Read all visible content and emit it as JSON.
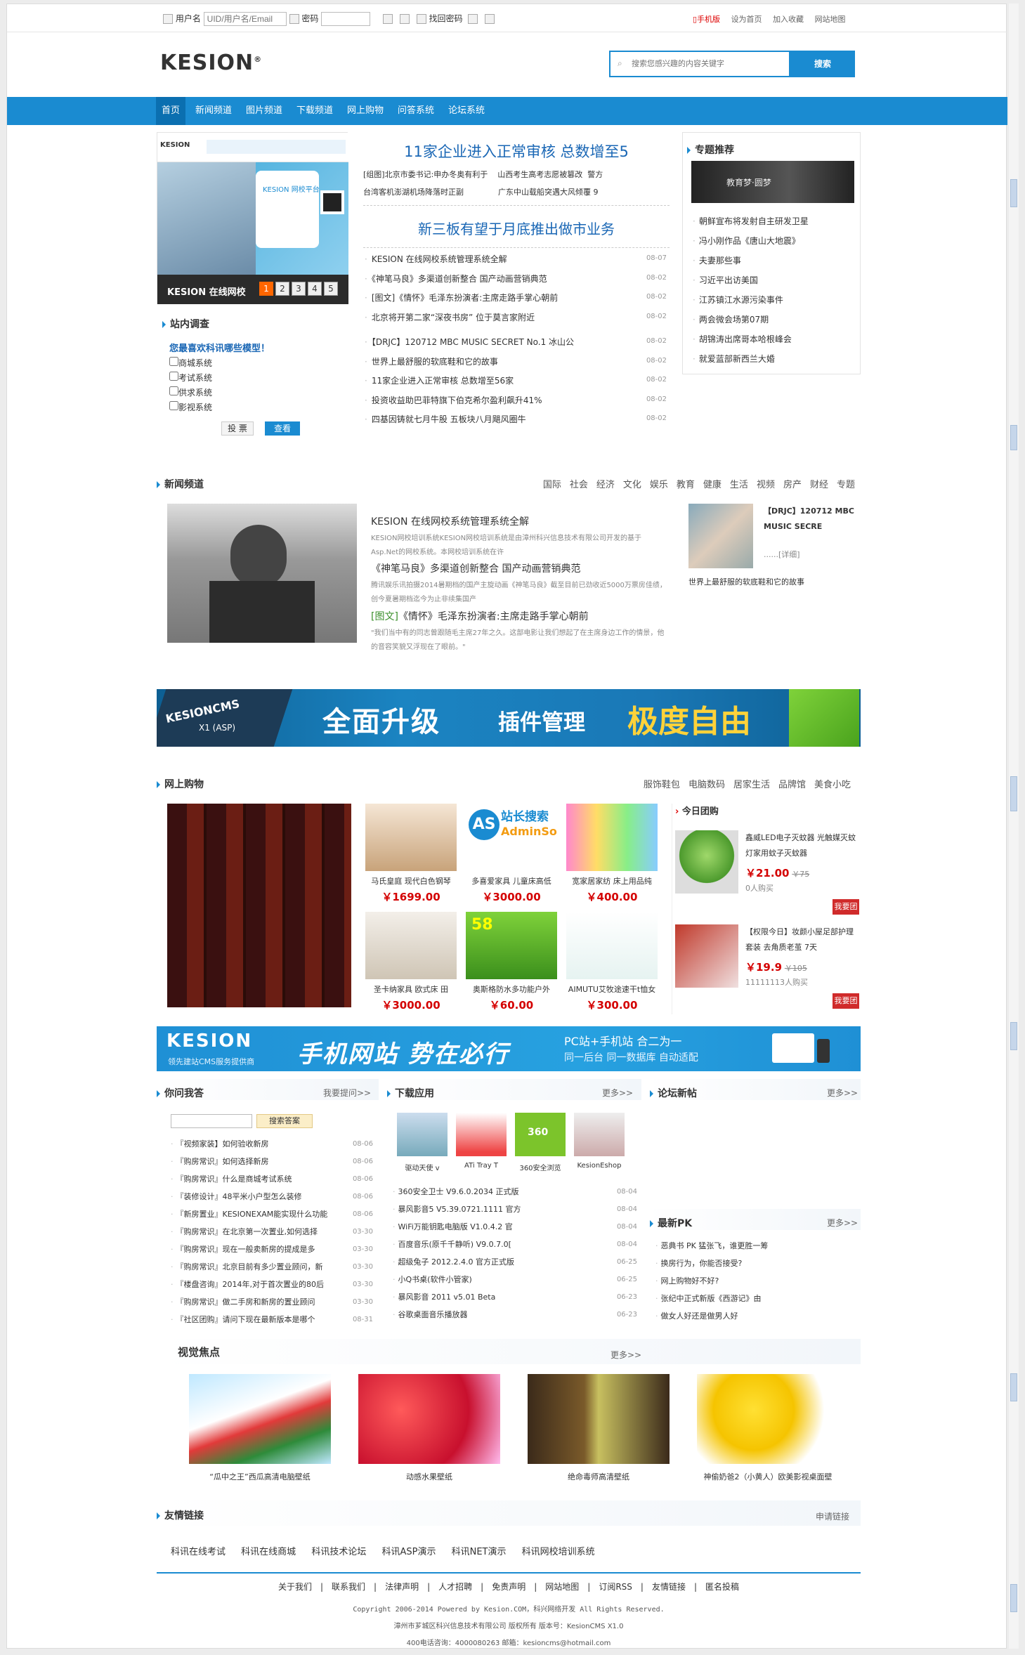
{
  "topbar": {
    "username_label": "用户名",
    "username_placeholder": "UID/用户名/Email",
    "password_label": "密码",
    "forgot": "找回密码",
    "links": [
      "手机版",
      "设为首页",
      "加入收藏",
      "网站地图"
    ]
  },
  "header": {
    "logo": "KESION",
    "logo_mark": "®",
    "search_placeholder": "搜索您感兴趣的内容关键字",
    "search_button": "搜索"
  },
  "nav": [
    "首页",
    "新闻频道",
    "图片频道",
    "下载频道",
    "网上购物",
    "问答系统",
    "论坛系统"
  ],
  "slider": {
    "caption": "KESION 在线网校",
    "pages": [
      "1",
      "2",
      "3",
      "4",
      "5"
    ],
    "banner_text": "KESION 网校平台"
  },
  "survey": {
    "title": "站内调查",
    "question": "您最喜欢科讯哪些模型！",
    "options": [
      "商城系统",
      "考试系统",
      "供求系统",
      "影视系统"
    ],
    "vote_btn": "投 票",
    "view_btn": "查看"
  },
  "headlines": {
    "h1": "11家企业进入正常审核  总数增至5",
    "h1_line1": "[组图]北京市委书记:申办冬奥有利于    山西考生高考志愿被篡改  警方",
    "h1_line2": "台湾客机澎湖机场降落时正副              广东中山载船突遇大风倾覆 9",
    "h2": "新三板有望于月底推出做市业务"
  },
  "newslist": [
    {
      "t": "KESION 在线网校系统管理系统全解",
      "d": "08-07"
    },
    {
      "t": "《神笔马良》多渠道创新整合 国产动画营销典范",
      "d": "08-02"
    },
    {
      "t": "[图文]《情怀》毛泽东扮演者:主席走路手掌心朝前",
      "d": "08-02"
    },
    {
      "t": "北京将开第二家“深夜书房” 位于莫言家附近",
      "d": "08-02"
    },
    {
      "t": "【DRJC】120712 MBC MUSIC SECRET No.1 冰山公",
      "d": "08-02"
    },
    {
      "t": "世界上最舒服的软底鞋和它的故事",
      "d": "08-02"
    },
    {
      "t": "11家企业进入正常审核 总数增至56家",
      "d": "08-02"
    },
    {
      "t": "投资收益助巴菲特旗下伯克希尔盈利飙升41%",
      "d": "08-02"
    },
    {
      "t": "四基因铸就七月牛股 五板块八月飓风圈牛",
      "d": "08-02"
    }
  ],
  "topics": {
    "title": "专题推荐",
    "items": [
      "朝鲜宣布将发射自主研发卫星",
      "冯小刚作品《唐山大地震》",
      "夫妻那些事",
      "习近平出访美国",
      "江苏镇江水源污染事件",
      "两会微会场第07期",
      "胡锦涛出席哥本哈根峰会",
      "就爱蓝部新西兰大婚"
    ],
    "img_text": "教育梦·圆梦"
  },
  "newsch": {
    "title": "新闻频道",
    "cats": [
      "国际",
      "社会",
      "经济",
      "文化",
      "娱乐",
      "教育",
      "健康",
      "生活",
      "视频",
      "房产",
      "财经",
      "专题"
    ],
    "a1_t": "KESION 在线网校系统管理系统全解",
    "a1_d": "KESION网校培训系统KESION网校培训系统是由漳州科兴信息技术有限公司开发的基于Asp.Net的网校系统。本网校培训系统在许",
    "a2_t": "《神笔马良》多渠道创新整合 国产动画营销典范",
    "a2_d": "腾讯娱乐讯拍摄2014暑期档的国产主旋动画《神笔马良》截至目前已劲收近5000万票房佳绩，创今夏暑期档迄今为止非续集国产",
    "a3_tag": "[图文]",
    "a3_t": "《情怀》毛泽东扮演者:主席走路手掌心朝前",
    "a3_d": "\"我们当中有的同志曾跟随毛主席27年之久。这部电影让我们想起了在主席身边工作的情景，他的音容笑貌又浮现在了眼前。\"",
    "side_t": "【DRJC】120712 MBC MUSIC SECRE",
    "side_more": "......[详细]",
    "side_link": "世界上最舒服的软底鞋和它的故事"
  },
  "banner1": {
    "brand": "KESIONCMS",
    "ver": "X1 (ASP)",
    "t1": "全面升级",
    "t2": "插件管理",
    "t3": "极度自由"
  },
  "shop": {
    "title": "网上购物",
    "cats": [
      "服饰鞋包",
      "电脑数码",
      "居家生活",
      "品牌馆",
      "美食小吃"
    ],
    "products": [
      {
        "name": "马氏皇庭 现代白色钢琴",
        "price": "￥1699.00"
      },
      {
        "name": "多喜爱家具 儿童床高低",
        "price": "￥3000.00"
      },
      {
        "name": "宽家居家纺 床上用品纯",
        "price": "￥400.00"
      },
      {
        "name": "圣卡纳家具 欧式床 田",
        "price": "￥3000.00"
      },
      {
        "name": "奥斯格防水多功能户外",
        "price": "￥60.00"
      },
      {
        "name": "AIMUTU艾牧途速干t恤女",
        "price": "￥300.00"
      }
    ],
    "p2_overlay": "站长搜索",
    "p2_overlay2": "AdminSo",
    "p5_overlay": "58",
    "group": {
      "title": "今日团购",
      "g1_t": "鑫威LED电子灭蚊器 光触媒灭蚊灯家用蚊子灭蚊器",
      "g1_price": "￥21.00",
      "g1_old": "￥75",
      "g1_count": "0人购买",
      "g2_t": "【权限今日】妆颜小屋足部护理套装 去角质老茧 7天",
      "g2_price": "￥19.9",
      "g2_old": "￥105",
      "g2_count": "11111113人购买",
      "btn": "我要团"
    }
  },
  "banner2": {
    "brand": "KESION",
    "sub": "领先建站CMS服务提供商",
    "t1": "手机网站 势在必行",
    "t2": "PC站+手机站 合二为一",
    "t3": "同一后台 同一数据库 自动适配"
  },
  "ask": {
    "title": "你问我答",
    "more": "我要提问>>",
    "btn": "搜索答案",
    "items": [
      {
        "t": "『视频家装】如何验收新房",
        "d": "08-06"
      },
      {
        "t": "『购房常识』如何选择新房",
        "d": "08-06"
      },
      {
        "t": "『购房常识』什么是商城考试系统",
        "d": "08-06"
      },
      {
        "t": "『装修设计』48平米小户型怎么装修",
        "d": "08-06"
      },
      {
        "t": "『新房置业』KESIONEXAM能实现什么功能",
        "d": "08-06"
      },
      {
        "t": "『购房常识』在北京第一次置业,如何选择",
        "d": "03-30"
      },
      {
        "t": "『购房常识』现在一般卖新房的提成是多",
        "d": "03-30"
      },
      {
        "t": "『购房常识』北京目前有多少置业顾问，新",
        "d": "03-30"
      },
      {
        "t": "『楼盘咨询』2014年,对于首次置业的80后",
        "d": "03-30"
      },
      {
        "t": "『购房常识』做二手房和新房的置业顾问",
        "d": "03-30"
      },
      {
        "t": "『社区团购』请问下现在最新版本是哪个",
        "d": "08-31"
      }
    ]
  },
  "down": {
    "title": "下载应用",
    "more": "更多>>",
    "apps": [
      "驱动天使 v",
      "ATi Tray T",
      "360安全浏览",
      "KesionEshop"
    ],
    "items": [
      {
        "t": "360安全卫士 V9.6.0.2034 正式版",
        "d": "08-04"
      },
      {
        "t": "暴风影音5 V5.39.0721.1111 官方",
        "d": "08-04"
      },
      {
        "t": "WiFi万能钥匙电脑版 V1.0.4.2 官",
        "d": "08-04"
      },
      {
        "t": "百度音乐(原千千静听) V9.0.7.0[",
        "d": "08-04"
      },
      {
        "t": "超级兔子 2012.2.4.0 官方正式版",
        "d": "06-25"
      },
      {
        "t": "小Q书桌(软件小管家)",
        "d": "06-25"
      },
      {
        "t": "暴风影音 2011 v5.01 Beta",
        "d": "06-23"
      },
      {
        "t": "谷歌桌面音乐播放器",
        "d": "06-23"
      }
    ]
  },
  "forum": {
    "title": "论坛新帖",
    "more": "更多>>"
  },
  "pk": {
    "title": "最新PK",
    "more": "更多>>",
    "items": [
      "恶典书 PK 猛张飞，谁更胜一筹",
      "换房行为，你能否接受?",
      "网上购物好不好?",
      "张纪中正式新版《西游记》由",
      "做女人好还是做男人好"
    ]
  },
  "visual": {
    "title": "视觉焦点",
    "more": "更多>>",
    "items": [
      "“瓜中之王”西瓜高清电脑壁纸",
      "动感水果壁纸",
      "绝命毒师高清壁纸",
      "神偷奶爸2（小黄人）欧美影视桌面壁"
    ]
  },
  "links": {
    "title": "友情链接",
    "apply": "申请链接",
    "items": [
      "科讯在线考试",
      "科讯在线商城",
      "科讯技术论坛",
      "科讯ASP演示",
      "科讯NET演示",
      "科讯网校培训系统"
    ]
  },
  "footer": {
    "links": [
      "关于我们",
      "联系我们",
      "法律声明",
      "人才招聘",
      "免责声明",
      "网站地图",
      "订阅RSS",
      "友情链接",
      "匿名投稿"
    ],
    "l1": "Copyright 2006-2014 Powered by Kesion.COM，科兴网络开发 All Rights Reserved.",
    "l2": "漳州市芗城区科兴信息技术有限公司 版权所有 版本号：KesionCMS X1.0",
    "l3": "400电话咨询：4000080263 邮箱：kesioncms@hotmail.com"
  },
  "colors": {
    "brand_blue": "#1a8bd1",
    "accent_red": "#d40000"
  }
}
